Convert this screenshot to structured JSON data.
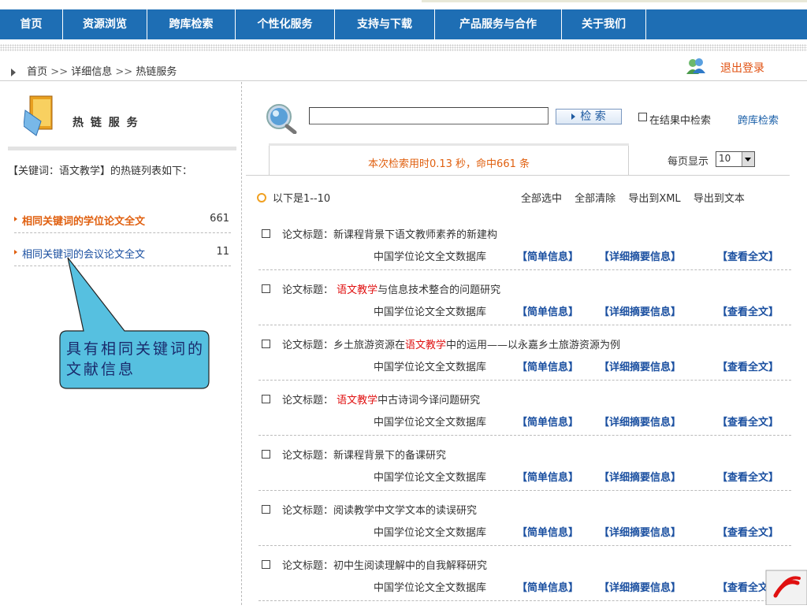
{
  "nav": {
    "items": [
      "首页",
      "资源浏览",
      "跨库检索",
      "个性化服务",
      "支持与下载",
      "产品服务与合作",
      "关于我们"
    ]
  },
  "breadcrumb": {
    "home": "首页",
    "sep": ">>",
    "detail": "详细信息",
    "current": "热链服务"
  },
  "user": {
    "logout": "退出登录"
  },
  "sidebar": {
    "title": "热 链 服 务",
    "intro": "【关键词：语文教学】的热链列表如下：",
    "items": [
      {
        "label": "相同关键词的学位论文全文",
        "count": "661"
      },
      {
        "label": "相同关键词的会议论文全文",
        "count": "11"
      }
    ]
  },
  "callout": {
    "text": "具有相同关键词的文献信息"
  },
  "search": {
    "value": "",
    "button": "检  索",
    "within": "在结果中检索",
    "cross": "跨库检索"
  },
  "stats": {
    "text": "本次检索用时0.13 秒，命中661 条",
    "perpage_label": "每页显示",
    "perpage_value": "10"
  },
  "list": {
    "range": "以下是1--10",
    "select_all": "全部选中",
    "clear_all": "全部清除",
    "export_xml": "导出到XML",
    "export_text": "导出到文本"
  },
  "result_labels": {
    "prefix": "论文标题：",
    "db": "中国学位论文全文数据库",
    "simple": "【简单信息】",
    "detail": "【详细摘要信息】",
    "full": "【查看全文】"
  },
  "results": [
    {
      "pre": "新课程背景下语文教师素养的新建构",
      "hl": "",
      "post": ""
    },
    {
      "pre": " ",
      "hl": "语文教学",
      "post": "与信息技术整合的问题研究"
    },
    {
      "pre": "乡土旅游资源在",
      "hl": "语文教学",
      "post": "中的运用——以永嘉乡土旅游资源为例"
    },
    {
      "pre": " ",
      "hl": "语文教学",
      "post": "中古诗词今译问题研究"
    },
    {
      "pre": "新课程背景下的备课研究",
      "hl": "",
      "post": ""
    },
    {
      "pre": "阅读教学中文学文本的读误研究",
      "hl": "",
      "post": ""
    },
    {
      "pre": "初中生阅读理解中的自我解释研究",
      "hl": "",
      "post": ""
    }
  ],
  "colors": {
    "nav": "#1e6eb4",
    "accent": "#e06010",
    "highlight": "#e01010",
    "link": "#1a4fa0",
    "callout": "#56c0e0"
  }
}
